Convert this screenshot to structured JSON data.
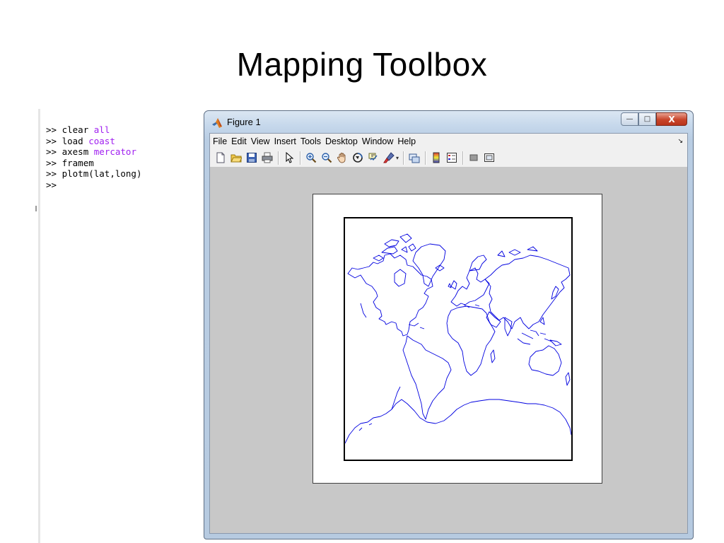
{
  "slide": {
    "title": "Mapping Toolbox"
  },
  "command_window": {
    "lines": [
      {
        "prompt": ">>",
        "cmd": "clear",
        "arg": "all"
      },
      {
        "prompt": ">>",
        "cmd": "load",
        "arg": "coast"
      },
      {
        "prompt": ">>",
        "cmd": "axesm",
        "arg": "mercator"
      },
      {
        "prompt": ">>",
        "cmd": "framem",
        "arg": ""
      },
      {
        "prompt": ">>",
        "cmd": "plotm(lat,long)",
        "arg": ""
      },
      {
        "prompt": ">>",
        "cmd": "",
        "arg": ""
      }
    ]
  },
  "figure_window": {
    "title": "Figure 1",
    "caption_buttons": {
      "minimize": "—",
      "maximize": "□",
      "close": "X"
    },
    "menu": [
      "File",
      "Edit",
      "View",
      "Insert",
      "Tools",
      "Desktop",
      "Window",
      "Help"
    ],
    "menu_overflow_icon": "↘",
    "toolbar_icons": [
      "new-figure-icon",
      "open-file-icon",
      "save-icon",
      "print-icon",
      "separator",
      "edit-plot-arrow-icon",
      "separator",
      "zoom-in-icon",
      "zoom-out-icon",
      "pan-hand-icon",
      "rotate-3d-icon",
      "data-cursor-icon",
      "brush-icon",
      "separator",
      "link-plot-icon",
      "separator",
      "colorbar-icon",
      "legend-icon",
      "separator",
      "hide-plot-tools-icon",
      "show-plot-tools-icon"
    ],
    "plot": {
      "line_color": "#0000e0",
      "projection": "mercator",
      "data": "coast"
    }
  }
}
